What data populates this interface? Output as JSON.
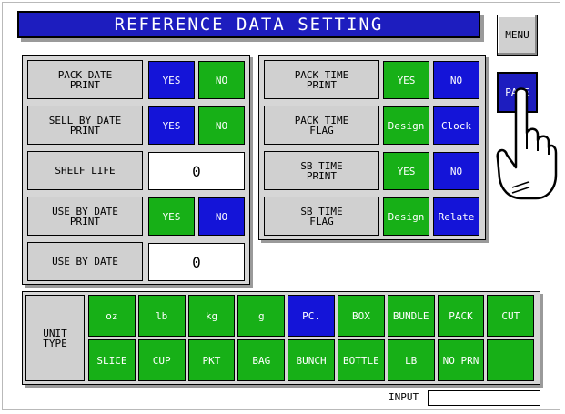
{
  "title": "REFERENCE DATA SETTING",
  "menu_label": "MENU",
  "page_label": "PAGE",
  "left_panel": {
    "pack_date_label": "PACK DATE\nPRINT",
    "pack_date_yes": "YES",
    "pack_date_no": "NO",
    "sell_by_label": "SELL BY DATE\nPRINT",
    "sell_by_yes": "YES",
    "sell_by_no": "NO",
    "shelf_life_label": "SHELF LIFE",
    "shelf_life_value": "0",
    "use_by_print_label": "USE BY DATE\nPRINT",
    "use_by_yes": "YES",
    "use_by_no": "NO",
    "use_by_date_label": "USE BY DATE",
    "use_by_date_value": "0"
  },
  "right_panel": {
    "pack_time_print_label": "PACK TIME\nPRINT",
    "pack_time_print_yes": "YES",
    "pack_time_print_no": "NO",
    "pack_time_flag_label": "PACK TIME\nFLAG",
    "pack_time_flag_design": "Design",
    "pack_time_flag_clock": "Clock",
    "sb_time_print_label": "SB TIME\nPRINT",
    "sb_time_print_yes": "YES",
    "sb_time_print_no": "NO",
    "sb_time_flag_label": "SB TIME\nFLAG",
    "sb_time_flag_design": "Design",
    "sb_time_flag_relate": "Relate"
  },
  "unit_type": {
    "label": "UNIT\nTYPE",
    "row1": [
      "oz",
      "lb",
      "kg",
      "g",
      "PC.",
      "BOX",
      "BUNDLE",
      "PACK",
      "CUT"
    ],
    "row2": [
      "SLICE",
      "CUP",
      "PKT",
      "BAG",
      "BUNCH",
      "BOTTLE",
      "LB",
      "NO PRN",
      ""
    ],
    "selected": "PC."
  },
  "input_label": "INPUT",
  "colors": {
    "blue": "#1414d8",
    "green": "#17b017",
    "title_blue": "#1d1dbf",
    "label_gray": "#d0d0d0"
  }
}
